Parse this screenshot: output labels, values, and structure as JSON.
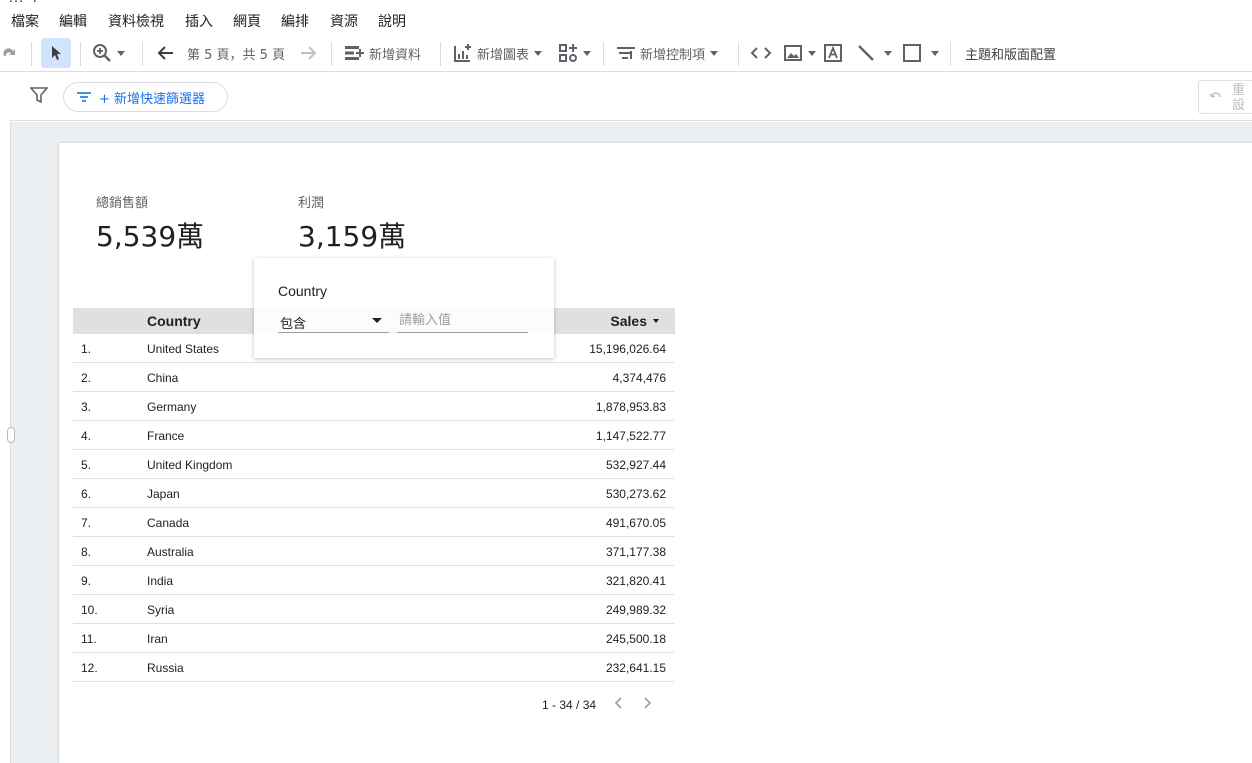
{
  "app": {
    "title_fragment": "…  ."
  },
  "menu": {
    "items": [
      "檔案",
      "編輯",
      "資料檢視",
      "插入",
      "網頁",
      "編排",
      "資源",
      "說明"
    ]
  },
  "toolbar": {
    "page_indicator": "第 5 頁，共 5 頁",
    "add_data": "新增資料",
    "add_chart": "新增圖表",
    "add_control": "新增控制項",
    "theme_layout": "主題和版面配置"
  },
  "filterbar": {
    "quick_filter": "+ 新增快速篩選器",
    "reset": "重設"
  },
  "scorecards": [
    {
      "label": "總銷售額",
      "value": "5,539萬"
    },
    {
      "label": "利潤",
      "value": "3,159萬"
    }
  ],
  "table": {
    "headers": {
      "country": "Country",
      "sales": "Sales"
    },
    "rows": [
      {
        "num": "1.",
        "country": "United States",
        "sales": "15,196,026.64"
      },
      {
        "num": "2.",
        "country": "China",
        "sales": "4,374,476"
      },
      {
        "num": "3.",
        "country": "Germany",
        "sales": "1,878,953.83"
      },
      {
        "num": "4.",
        "country": "France",
        "sales": "1,147,522.77"
      },
      {
        "num": "5.",
        "country": "United Kingdom",
        "sales": "532,927.44"
      },
      {
        "num": "6.",
        "country": "Japan",
        "sales": "530,273.62"
      },
      {
        "num": "7.",
        "country": "Canada",
        "sales": "491,670.05"
      },
      {
        "num": "8.",
        "country": "Australia",
        "sales": "371,177.38"
      },
      {
        "num": "9.",
        "country": "India",
        "sales": "321,820.41"
      },
      {
        "num": "10.",
        "country": "Syria",
        "sales": "249,989.32"
      },
      {
        "num": "11.",
        "country": "Iran",
        "sales": "245,500.18"
      },
      {
        "num": "12.",
        "country": "Russia",
        "sales": "232,641.15"
      }
    ],
    "pagination": "1 - 34 / 34"
  },
  "filter_popup": {
    "title": "Country",
    "operator": "包含",
    "placeholder": "請輸入值"
  },
  "colors": {
    "accent": "#1a73e8",
    "select_highlight": "#d2e3fc",
    "header_bg": "#e0e0e0",
    "canvas_bg": "#eceff1"
  }
}
